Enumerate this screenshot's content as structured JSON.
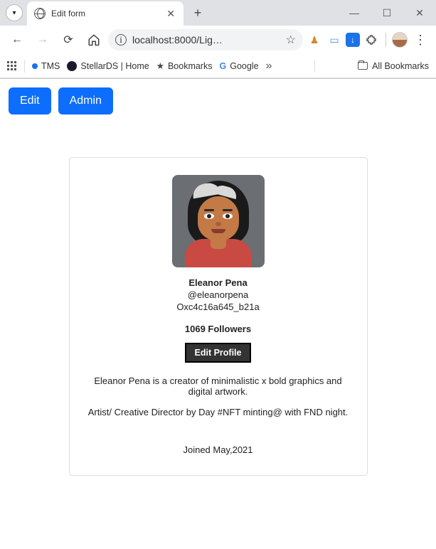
{
  "browser": {
    "tab_title": "Edit form",
    "url_display": "localhost:8000/Lig…",
    "bookmarks": {
      "tms": "TMS",
      "stellards": "StellarDS | Home",
      "bookmarks": "Bookmarks",
      "google": "Google",
      "all": "All Bookmarks"
    }
  },
  "page": {
    "buttons": {
      "edit": "Edit",
      "admin": "Admin"
    },
    "profile": {
      "name": "Eleanor Pena",
      "handle": "@eleanorpena",
      "wallet": "Oxc4c16a645_b21a",
      "followers": "1069 Followers",
      "edit_label": "Edit Profile",
      "bio_line1": "Eleanor Pena is a creator of minimalistic x bold graphics and digital artwork.",
      "bio_line2": "Artist/ Creative Director by Day #NFT minting@ with FND night.",
      "joined": "Joined May,2021"
    }
  }
}
